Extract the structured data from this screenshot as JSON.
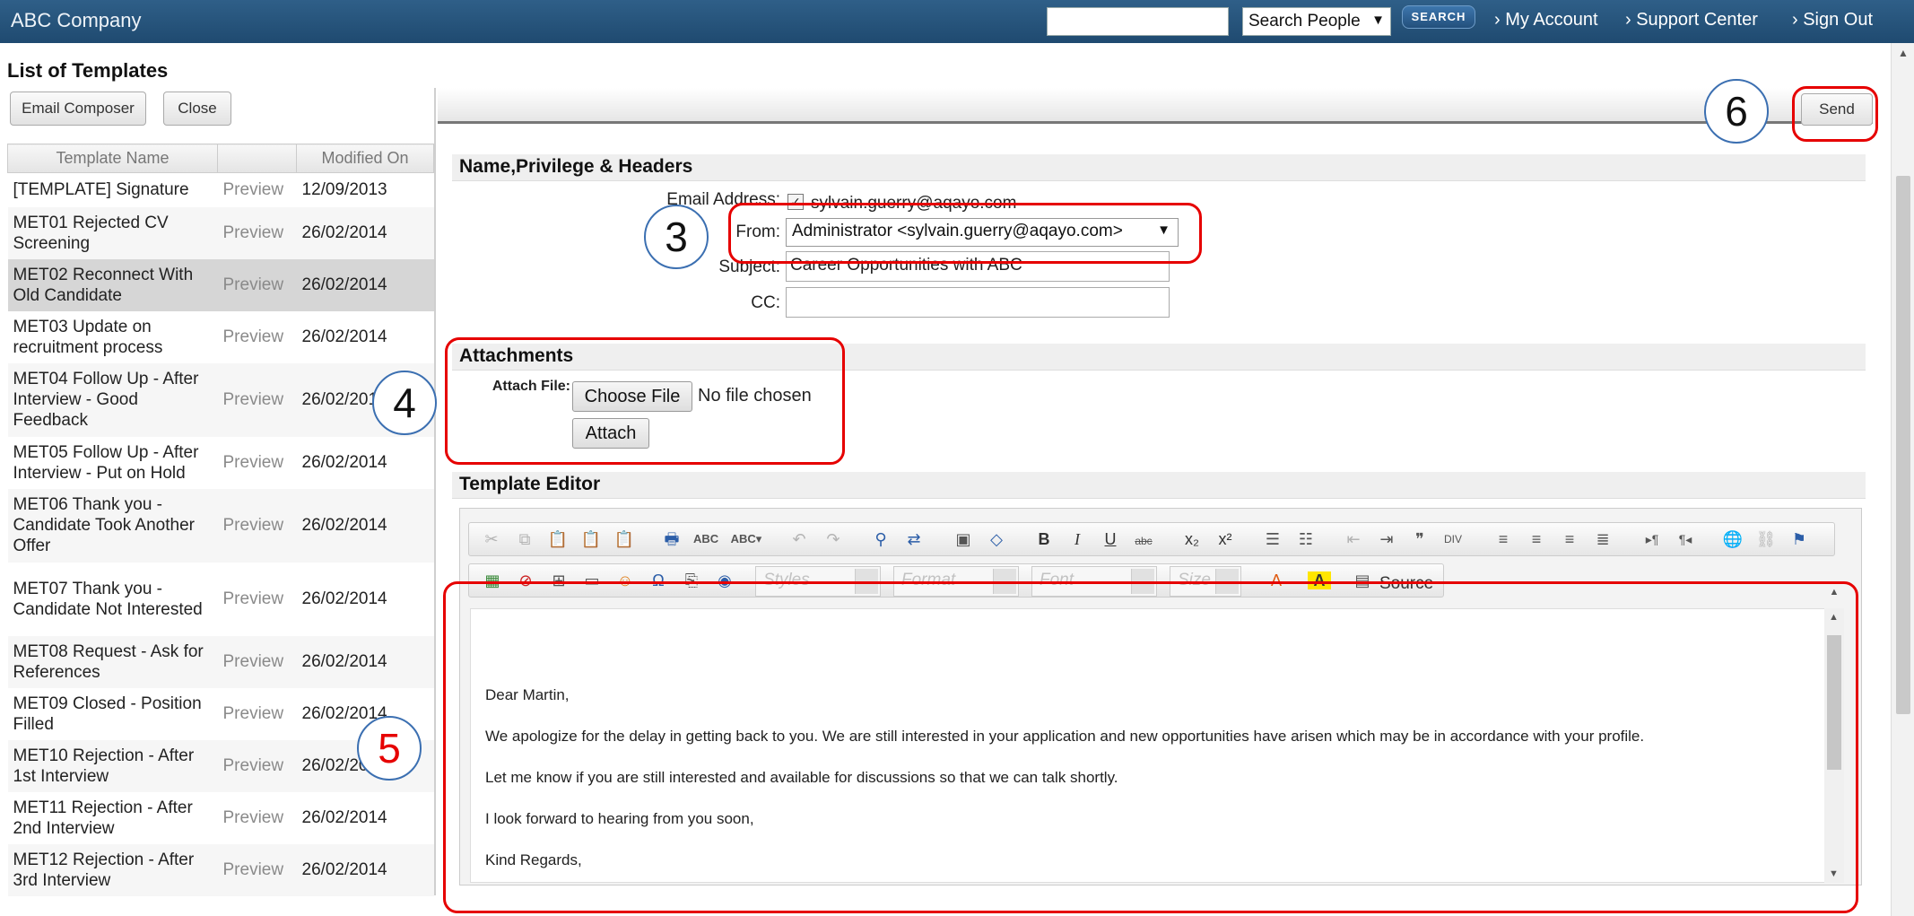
{
  "header": {
    "brand": "ABC Company",
    "search_placeholder": "",
    "people_select": "Search People",
    "search_button": "SEARCH",
    "links": [
      "› My Account",
      "› Support Center",
      "› Sign Out"
    ]
  },
  "left_panel": {
    "title": "List of Templates",
    "buttons": {
      "composer": "Email Composer",
      "close": "Close"
    },
    "columns": [
      "Template Name",
      "",
      "Modified On"
    ],
    "rows": [
      {
        "name": "[TEMPLATE] Signature",
        "preview": "Preview",
        "date": "12/09/2013"
      },
      {
        "name": "MET01 Rejected CV Screening",
        "preview": "Preview",
        "date": "26/02/2014"
      },
      {
        "name": "MET02 Reconnect With Old Candidate",
        "preview": "Preview",
        "date": "26/02/2014"
      },
      {
        "name": "MET03 Update on recruitment process",
        "preview": "Preview",
        "date": "26/02/2014"
      },
      {
        "name": "MET04 Follow Up - After Interview - Good Feedback",
        "preview": "Preview",
        "date": "26/02/2014"
      },
      {
        "name": "MET05 Follow Up - After Interview - Put on Hold",
        "preview": "Preview",
        "date": "26/02/2014"
      },
      {
        "name": "MET06 Thank you - Candidate Took Another Offer",
        "preview": "Preview",
        "date": "26/02/2014"
      },
      {
        "name": "MET07 Thank you - Candidate Not Interested",
        "preview": "Preview",
        "date": "26/02/2014"
      },
      {
        "name": "MET08 Request - Ask for References",
        "preview": "Preview",
        "date": "26/02/2014"
      },
      {
        "name": "MET09 Closed - Position Filled",
        "preview": "Preview",
        "date": "26/02/2014"
      },
      {
        "name": "MET10 Rejection - After 1st Interview",
        "preview": "Preview",
        "date": "26/02/2014"
      },
      {
        "name": "MET11 Rejection - After 2nd Interview",
        "preview": "Preview",
        "date": "26/02/2014"
      },
      {
        "name": "MET12 Rejection - After 3rd Interview",
        "preview": "Preview",
        "date": "26/02/2014"
      }
    ],
    "selected_index": 2
  },
  "send_button": "Send",
  "headers_section": {
    "title": "Name,Privilege & Headers",
    "email_label": "Email Address:",
    "email_value": "sylvain.guerry@aqayo.com",
    "email_checked": true,
    "from_label": "From:",
    "from_value": "Administrator <sylvain.guerry@aqayo.com>",
    "subject_label": "Subject:",
    "subject_value": "Career Opportunities with ABC",
    "cc_label": "CC:",
    "cc_value": ""
  },
  "attachments": {
    "title": "Attachments",
    "label": "Attach File:",
    "choose_button": "Choose File",
    "no_file": "No file chosen",
    "attach_button": "Attach"
  },
  "editor": {
    "title": "Template Editor",
    "styles": "Styles",
    "format": "Format",
    "font": "Font",
    "size": "Size",
    "source": "Source",
    "body_lines": [
      "Dear Martin,",
      "We apologize for the delay in getting back to you. We are still interested in your application and new opportunities have arisen which may be in accordance with your profile.",
      "Let me know if you are still interested and available for discussions so that we can talk shortly.",
      "I look forward to hearing from you soon,",
      "Kind Regards,"
    ]
  },
  "annotations": [
    "3",
    "4",
    "5",
    "6"
  ],
  "colors": {
    "topbar": "#1f4a70",
    "annotation_red": "#e60000",
    "circle_blue": "#3b6fb1"
  }
}
